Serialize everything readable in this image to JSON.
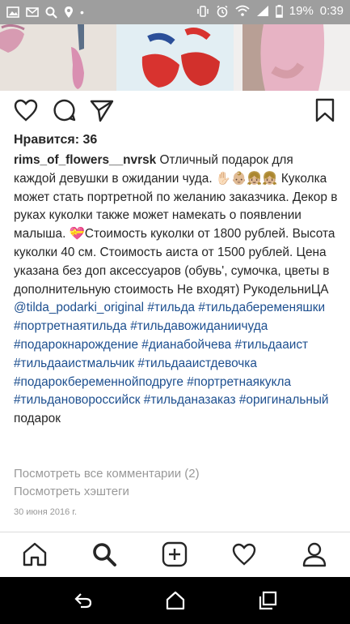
{
  "status_bar": {
    "battery_percent": "19%",
    "time": "0:39",
    "icons": [
      "image-icon",
      "mail-icon",
      "search-icon",
      "location-icon",
      "vibrate-icon",
      "alarm-icon",
      "wifi-icon",
      "signal-icon",
      "battery-icon"
    ]
  },
  "post": {
    "likes_text": "Нравится: 36",
    "username": "rims_of_flowers__nvrsk",
    "caption_part1": " Отличный подарок для каждой девушки в ожидании чуда. ",
    "emoji_1": "✋🏻👶🏼👧🏼👧🏼",
    "caption_part2": " Куколка может стать портретной по желанию заказчика. Декор в руках куколки также может намекать о появлении малыша. ",
    "emoji_2": "💝",
    "caption_part3": "Стоимость куколки от 1800 рублей. Высота куколки 40 см. Стоимость аиста от 1500 рублей. Цена указана без доп аксессуаров (обувь', сумочка, цветы в дополнительную стоимость Не входят) РукодельниЦА ",
    "mention": "@tilda_podarki_original",
    "hashtags": [
      "#тильда",
      "#тильдабеременяшки",
      "#портретнаятильда",
      "#тильдавожиданиичуда",
      "#подарокнарождение",
      "#дианабойчева",
      "#тильдааист",
      "#тильдааистмальчик",
      "#тильдааистдевочка",
      "#подарокбеременнойподруге",
      "#портретнаякукла",
      "#тильдановороссийск",
      "#тильданазаказ",
      "#оригинальный"
    ],
    "caption_end": " подарок",
    "view_comments": "Посмотреть все комментарии (2)",
    "view_hashtags": "Посмотреть хэштеги",
    "date": "30 июня 2016 г."
  },
  "actions": [
    "heart-icon",
    "comment-icon",
    "share-icon",
    "bookmark-icon"
  ],
  "tab_bar": [
    "home-icon",
    "search-icon",
    "add-icon",
    "activity-icon",
    "profile-icon"
  ],
  "nav_bar": [
    "back-icon",
    "home-icon",
    "recents-icon"
  ],
  "colors": {
    "hashtag": "#1d4f8f",
    "status_bar": "#9e9e9e",
    "muted_text": "#999999"
  }
}
